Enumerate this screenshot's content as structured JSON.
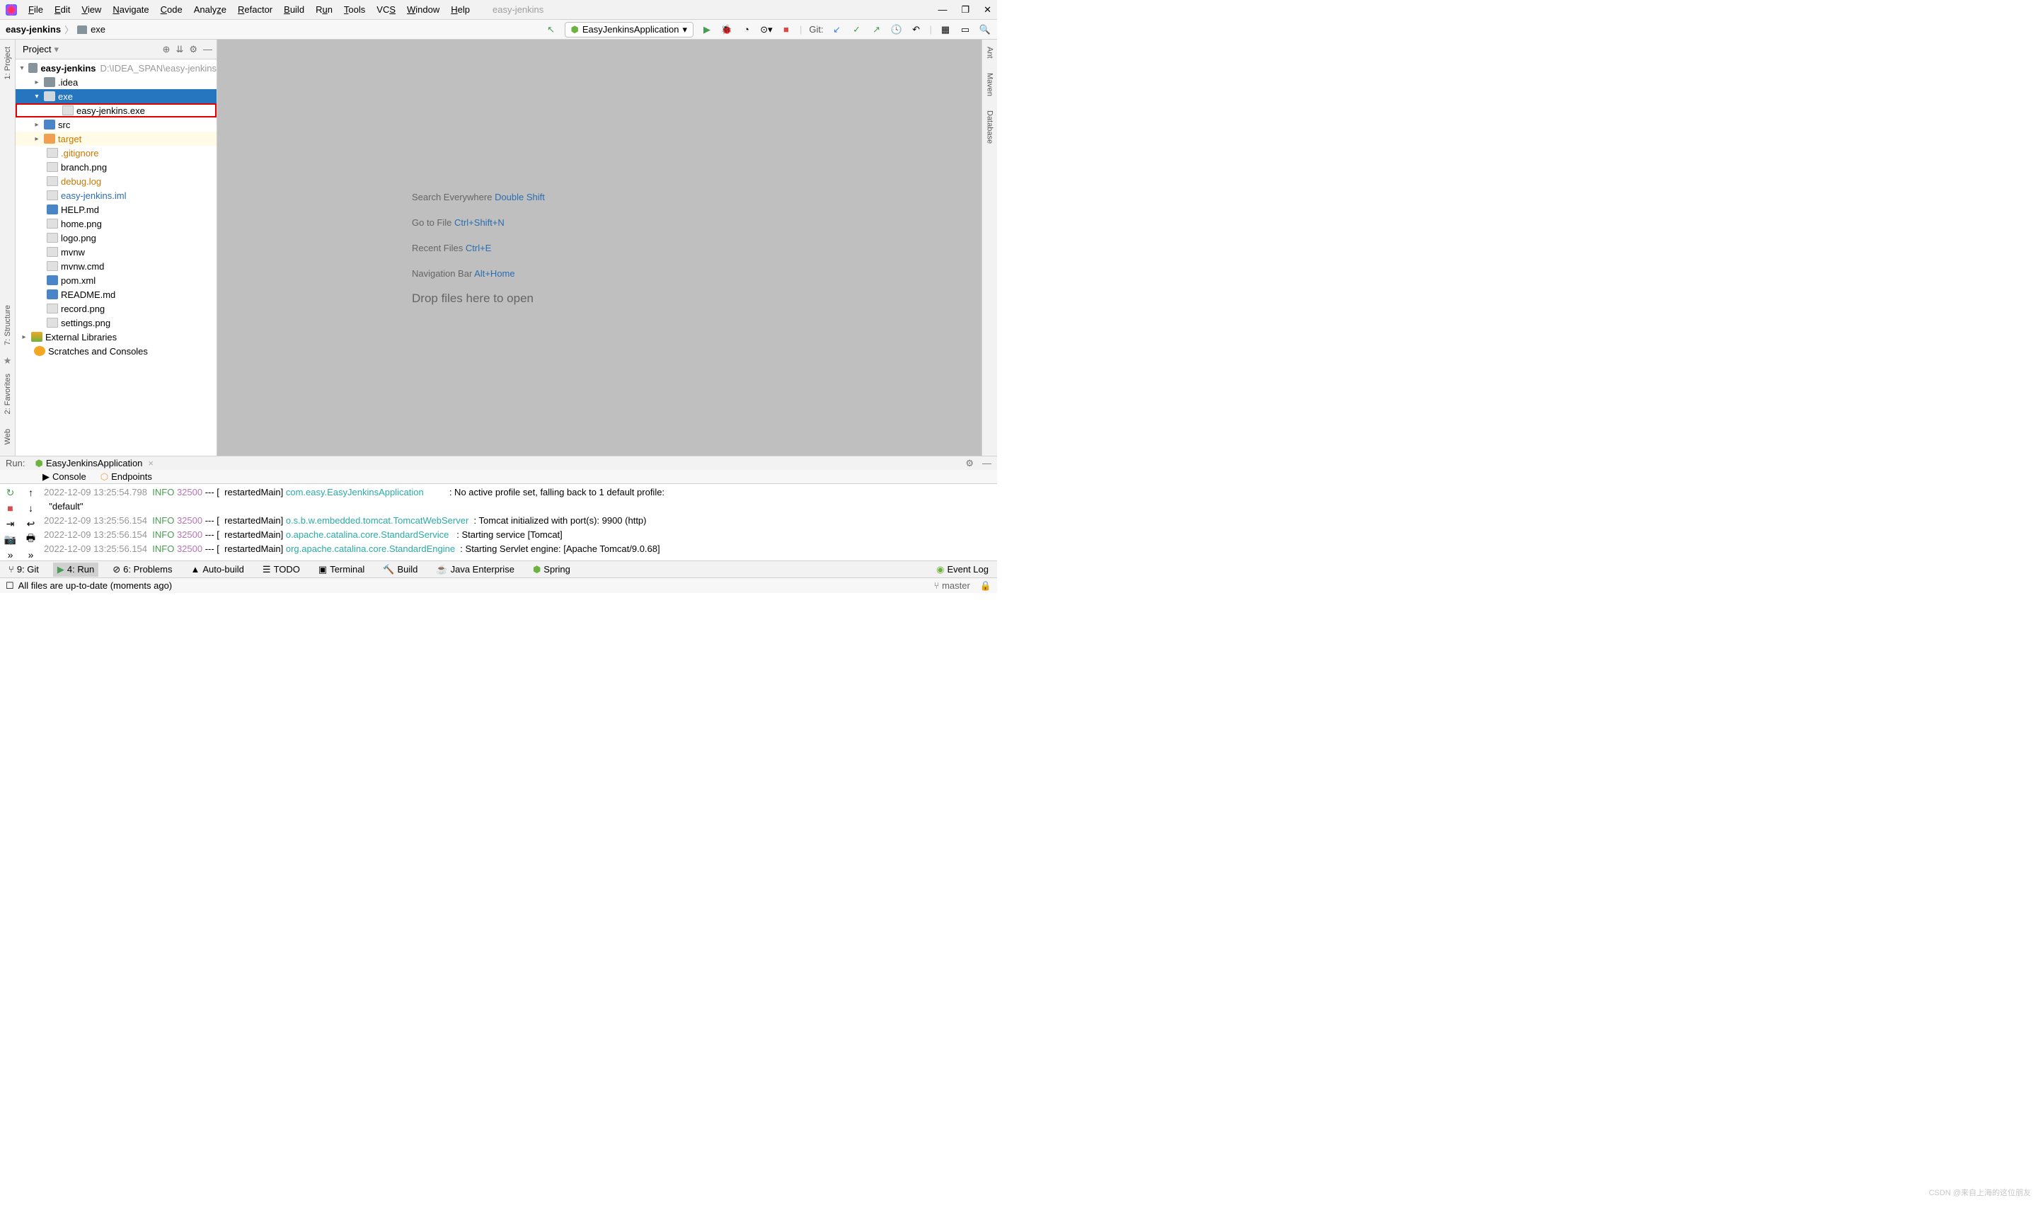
{
  "app_title": "easy-jenkins",
  "menu": [
    "File",
    "Edit",
    "View",
    "Navigate",
    "Code",
    "Analyze",
    "Refactor",
    "Build",
    "Run",
    "Tools",
    "VCS",
    "Window",
    "Help"
  ],
  "breadcrumb": {
    "root": "easy-jenkins",
    "child": "exe"
  },
  "run_config": {
    "name": "EasyJenkinsApplication"
  },
  "git_label": "Git:",
  "project_panel": {
    "title": "Project"
  },
  "tree": {
    "root": {
      "name": "easy-jenkins",
      "path": "D:\\IDEA_SPAN\\easy-jenkins"
    },
    "idea": ".idea",
    "exe": "exe",
    "exe_file": "easy-jenkins.exe",
    "src": "src",
    "target": "target",
    "gitignore": ".gitignore",
    "branch": "branch.png",
    "debug": "debug.log",
    "iml": "easy-jenkins.iml",
    "help": "HELP.md",
    "home": "home.png",
    "logo": "logo.png",
    "mvnw": "mvnw",
    "mvnwcmd": "mvnw.cmd",
    "pom": "pom.xml",
    "readme": "README.md",
    "record": "record.png",
    "settings": "settings.png",
    "extlib": "External Libraries",
    "scratches": "Scratches and Consoles"
  },
  "editor_hints": {
    "search": {
      "label": "Search Everywhere ",
      "key": "Double Shift"
    },
    "gotofile": {
      "label": "Go to File ",
      "key": "Ctrl+Shift+N"
    },
    "recent": {
      "label": "Recent Files ",
      "key": "Ctrl+E"
    },
    "navbar": {
      "label": "Navigation Bar ",
      "key": "Alt+Home"
    },
    "drop": "Drop files here to open"
  },
  "run_panel": {
    "label": "Run:",
    "tab": "EasyJenkinsApplication",
    "console_tab": "Console",
    "endpoints_tab": "Endpoints"
  },
  "console": [
    {
      "ts": "2022-12-09 13:25:54.798",
      "lvl": "INFO",
      "pid": "32500",
      "thr": "restartedMain",
      "cls": "com.easy.EasyJenkinsApplication",
      "msg": ": No active profile set, falling back to 1 default profile:",
      "trail": "\"default\""
    },
    {
      "ts": "2022-12-09 13:25:56.154",
      "lvl": "INFO",
      "pid": "32500",
      "thr": "restartedMain",
      "cls": "o.s.b.w.embedded.tomcat.TomcatWebServer",
      "msg": ": Tomcat initialized with port(s): 9900 (http)"
    },
    {
      "ts": "2022-12-09 13:25:56.154",
      "lvl": "INFO",
      "pid": "32500",
      "thr": "restartedMain",
      "cls": "o.apache.catalina.core.StandardService",
      "msg": ": Starting service [Tomcat]"
    },
    {
      "ts": "2022-12-09 13:25:56.154",
      "lvl": "INFO",
      "pid": "32500",
      "thr": "restartedMain",
      "cls": "org.apache.catalina.core.StandardEngine",
      "msg": ": Starting Servlet engine: [Apache Tomcat/9.0.68]"
    }
  ],
  "bottom_tabs": {
    "git": "9: Git",
    "run": "4: Run",
    "problems": "6: Problems",
    "autobuild": "Auto-build",
    "todo": "TODO",
    "terminal": "Terminal",
    "build": "Build",
    "javaee": "Java Enterprise",
    "spring": "Spring",
    "eventlog": "Event Log"
  },
  "statusbar": {
    "msg": "All files are up-to-date (moments ago)",
    "branch": "master"
  },
  "watermark": "CSDN @来自上海的这位朋友",
  "left_rail": {
    "project": "1: Project",
    "structure": "7: Structure",
    "favorites": "2: Favorites",
    "web": "Web"
  },
  "right_rail": {
    "ant": "Ant",
    "maven": "Maven",
    "database": "Database"
  }
}
